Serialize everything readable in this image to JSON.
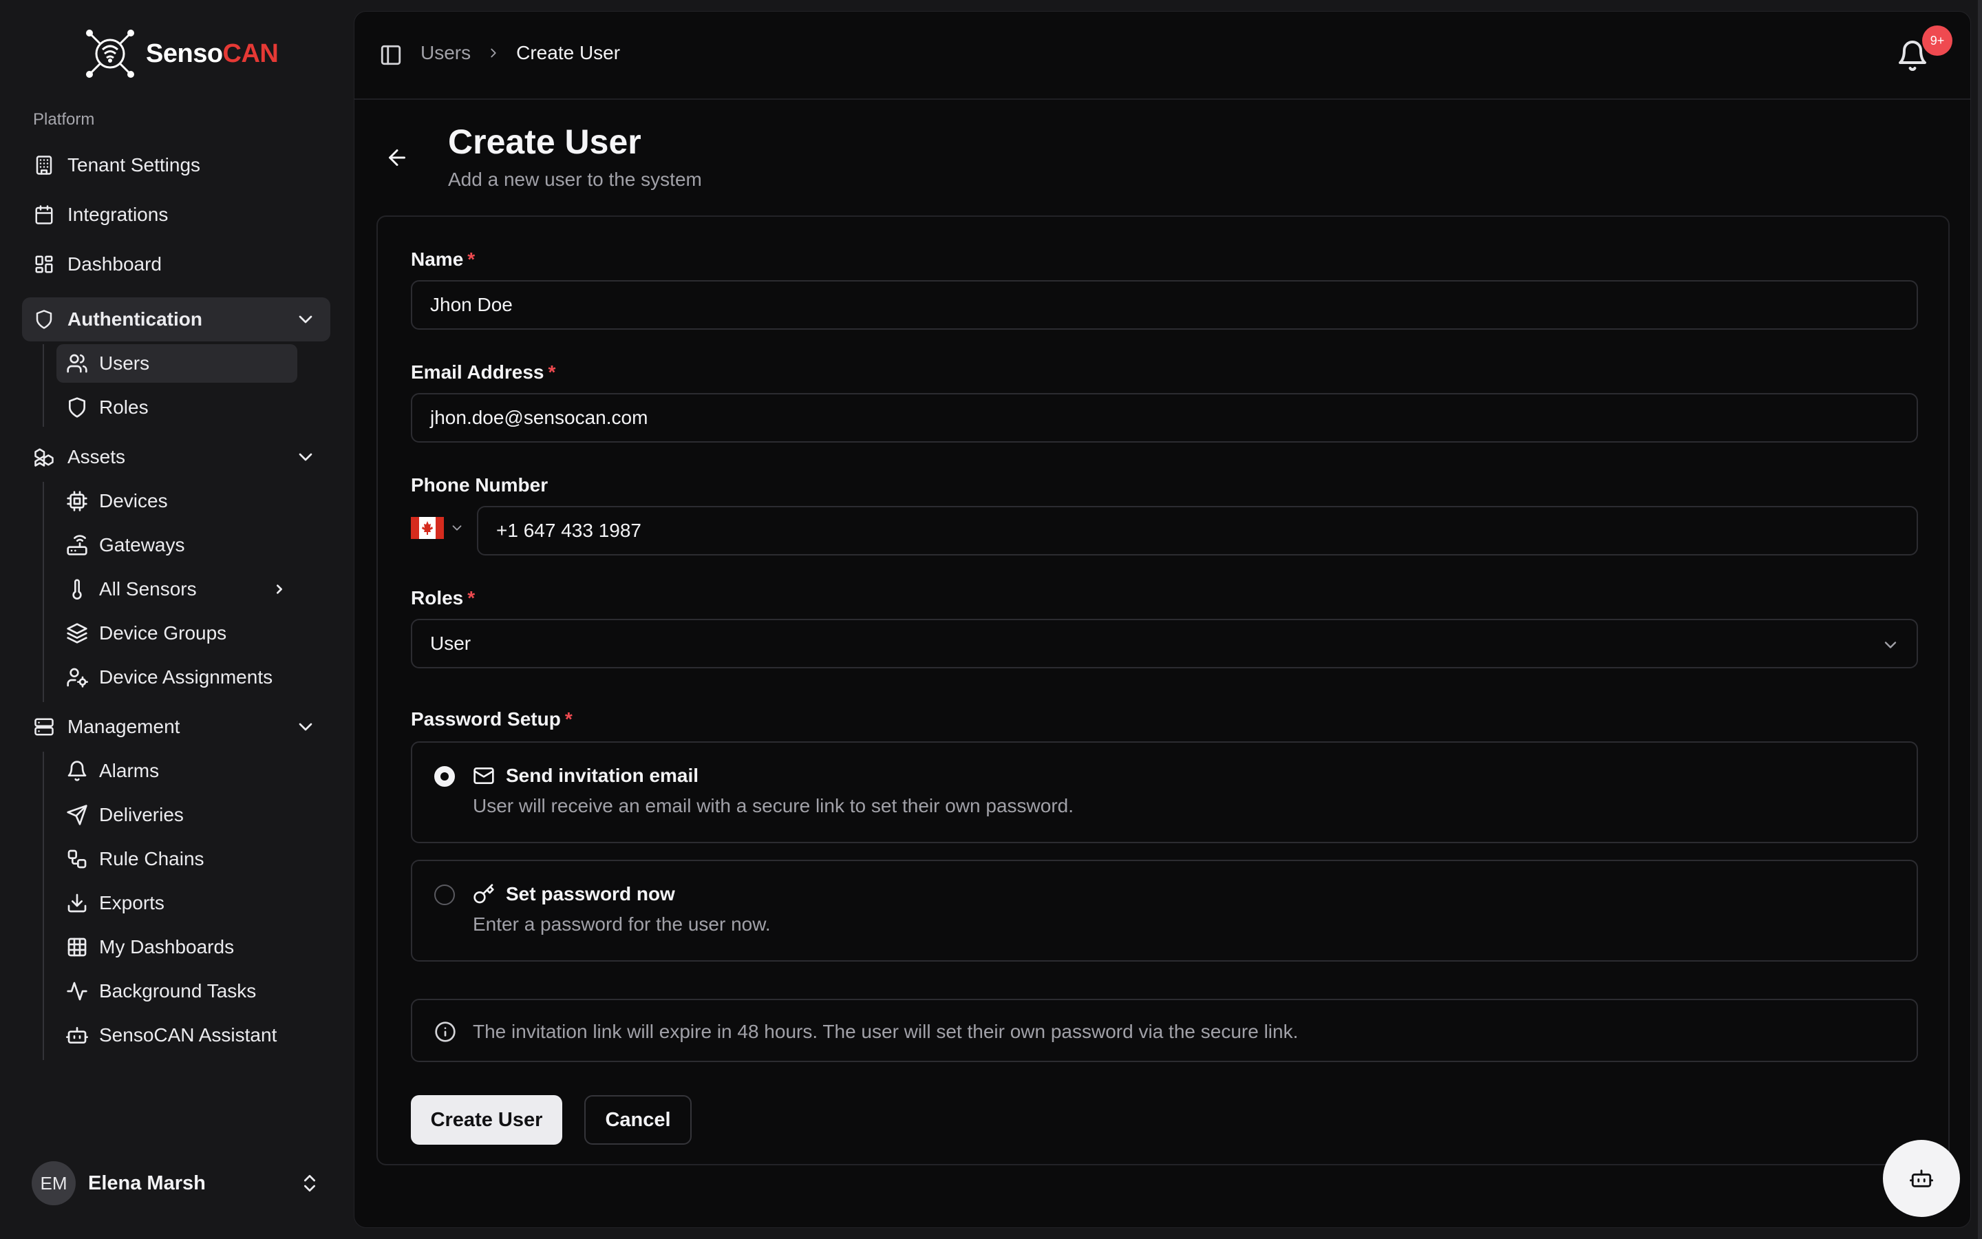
{
  "brand": {
    "name_main": "Senso",
    "name_accent": "CAN",
    "accent_color": "#e53935"
  },
  "sidebar": {
    "group_label": "Platform",
    "items": [
      {
        "label": "Tenant Settings",
        "icon": "building-icon"
      },
      {
        "label": "Integrations",
        "icon": "calendar-icon"
      },
      {
        "label": "Dashboard",
        "icon": "layout-dashboard-icon"
      },
      {
        "label": "Authentication",
        "icon": "shield-icon",
        "expanded": true,
        "active": true,
        "children": [
          {
            "label": "Users",
            "icon": "users-icon",
            "active": true
          },
          {
            "label": "Roles",
            "icon": "shield-icon"
          }
        ]
      },
      {
        "label": "Assets",
        "icon": "boxes-icon",
        "expanded": true,
        "children": [
          {
            "label": "Devices",
            "icon": "cpu-icon"
          },
          {
            "label": "Gateways",
            "icon": "router-icon"
          },
          {
            "label": "All Sensors",
            "icon": "thermometer-icon"
          },
          {
            "label": "Device Groups",
            "icon": "layers-icon"
          },
          {
            "label": "Device Assignments",
            "icon": "user-cog-icon"
          }
        ]
      },
      {
        "label": "Management",
        "icon": "server-icon",
        "expanded": true,
        "children": [
          {
            "label": "Alarms",
            "icon": "bell-icon"
          },
          {
            "label": "Deliveries",
            "icon": "send-icon"
          },
          {
            "label": "Rule Chains",
            "icon": "workflow-icon"
          },
          {
            "label": "Exports",
            "icon": "download-icon"
          },
          {
            "label": "My Dashboards",
            "icon": "grid-icon"
          },
          {
            "label": "Background Tasks",
            "icon": "activity-icon"
          },
          {
            "label": "SensoCAN Assistant",
            "icon": "bot-icon"
          }
        ]
      }
    ],
    "user": {
      "initials": "EM",
      "name": "Elena Marsh"
    }
  },
  "header": {
    "breadcrumb_parent": "Users",
    "breadcrumb_current": "Create User",
    "notification_badge": "9+"
  },
  "page": {
    "title": "Create User",
    "subtitle": "Add a new user to the system"
  },
  "form": {
    "name_label": "Name",
    "name_value": "Jhon Doe",
    "email_label": "Email Address",
    "email_value": "jhon.doe@sensocan.com",
    "phone_label": "Phone Number",
    "phone_country": "CA",
    "phone_value": "+1 647 433 1987",
    "roles_label": "Roles",
    "roles_value": "User",
    "password_label": "Password Setup",
    "required_mark": "*",
    "options": [
      {
        "title": "Send invitation email",
        "description": "User will receive an email with a secure link to set their own password.",
        "selected": true,
        "icon": "mail-icon"
      },
      {
        "title": "Set password now",
        "description": "Enter a password for the user now.",
        "selected": false,
        "icon": "key-icon"
      }
    ],
    "info_text": "The invitation link will expire in 48 hours. The user will set their own password via the secure link.",
    "submit_label": "Create User",
    "cancel_label": "Cancel"
  }
}
